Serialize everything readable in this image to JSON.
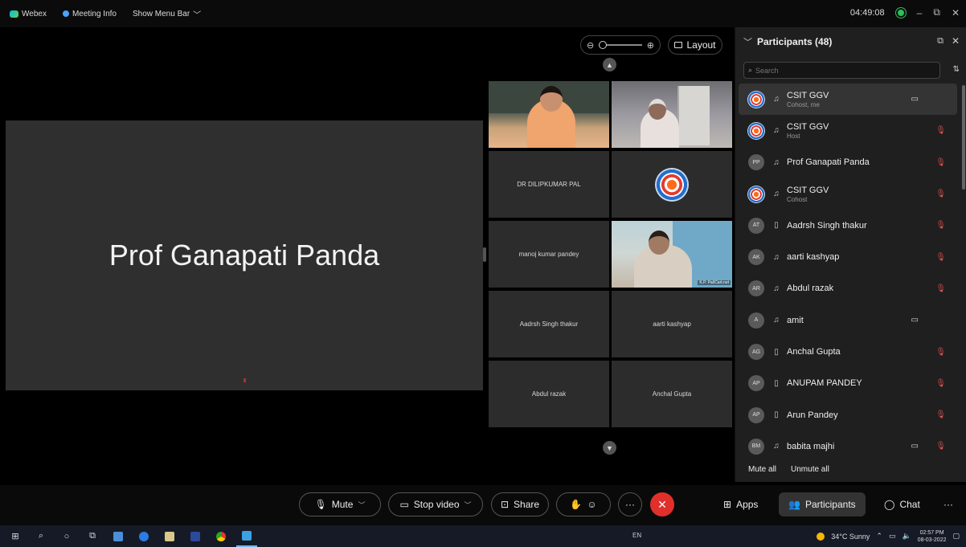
{
  "titlebar": {
    "app": "Webex",
    "meeting_info": "Meeting Info",
    "show_menu": "Show Menu Bar",
    "timer": "04:49:08",
    "minimize": "–",
    "restore": "⧉",
    "close": "✕"
  },
  "view_controls": {
    "zoom_out": "⊖",
    "zoom_in": "⊕",
    "layout_label": "Layout"
  },
  "stage": {
    "speaker_name": "Prof Ganapati Panda"
  },
  "tiles": {
    "dilipkumar": "DR DILIPKUMAR PAL",
    "manoj": "manoj kumar pandey",
    "video_tag": "K.P. Pal/Cart.net",
    "aadrsh": "Aadrsh Singh thakur",
    "aarti": "aarti kashyap",
    "abdul": "Abdul razak",
    "anchal": "Anchal Gupta"
  },
  "participants_panel": {
    "title": "Participants (48)",
    "search_placeholder": "Search",
    "mute_all": "Mute all",
    "unmute_all": "Unmute all",
    "items": [
      {
        "initials": "",
        "name": "CSIT GGV",
        "role": "Cohost, me",
        "device": "headset",
        "camera": true,
        "muted": false,
        "avatar_img": true
      },
      {
        "initials": "",
        "name": "CSIT GGV",
        "role": "Host",
        "device": "headset",
        "camera": false,
        "muted": true,
        "avatar_img": true
      },
      {
        "initials": "PP",
        "name": "Prof Ganapati Panda",
        "role": "",
        "device": "headset",
        "camera": false,
        "muted": true,
        "avatar_img": false
      },
      {
        "initials": "",
        "name": "CSIT GGV",
        "role": "Cohost",
        "device": "headset",
        "camera": false,
        "muted": true,
        "avatar_img": true
      },
      {
        "initials": "AT",
        "name": "Aadrsh Singh thakur",
        "role": "",
        "device": "phone",
        "camera": false,
        "muted": true,
        "avatar_img": false
      },
      {
        "initials": "AK",
        "name": "aarti kashyap",
        "role": "",
        "device": "headset",
        "camera": false,
        "muted": true,
        "avatar_img": false
      },
      {
        "initials": "AR",
        "name": "Abdul razak",
        "role": "",
        "device": "headset",
        "camera": false,
        "muted": true,
        "avatar_img": false
      },
      {
        "initials": "A",
        "name": "amit",
        "role": "",
        "device": "headset",
        "camera": true,
        "muted": false,
        "avatar_img": false
      },
      {
        "initials": "AG",
        "name": "Anchal Gupta",
        "role": "",
        "device": "phone",
        "camera": false,
        "muted": true,
        "avatar_img": false
      },
      {
        "initials": "AP",
        "name": "ANUPAM PANDEY",
        "role": "",
        "device": "phone",
        "camera": false,
        "muted": true,
        "avatar_img": false
      },
      {
        "initials": "AP",
        "name": "Arun Pandey",
        "role": "",
        "device": "phone",
        "camera": false,
        "muted": true,
        "avatar_img": false
      },
      {
        "initials": "BM",
        "name": "babita majhi",
        "role": "",
        "device": "headset",
        "camera": true,
        "muted": true,
        "avatar_img": false
      }
    ]
  },
  "controls": {
    "mute": "Mute",
    "stop_video": "Stop video",
    "share": "Share",
    "apps": "Apps",
    "participants": "Participants",
    "chat": "Chat",
    "more": "···",
    "leave": "✕"
  },
  "taskbar": {
    "lang": "EN",
    "weather": "34°C Sunny",
    "time": "02:57 PM",
    "date": "08-03-2022"
  },
  "colors": {
    "leave_red": "#e0302b",
    "accent_green": "#2dbf5d",
    "muted_red": "#e05050"
  }
}
